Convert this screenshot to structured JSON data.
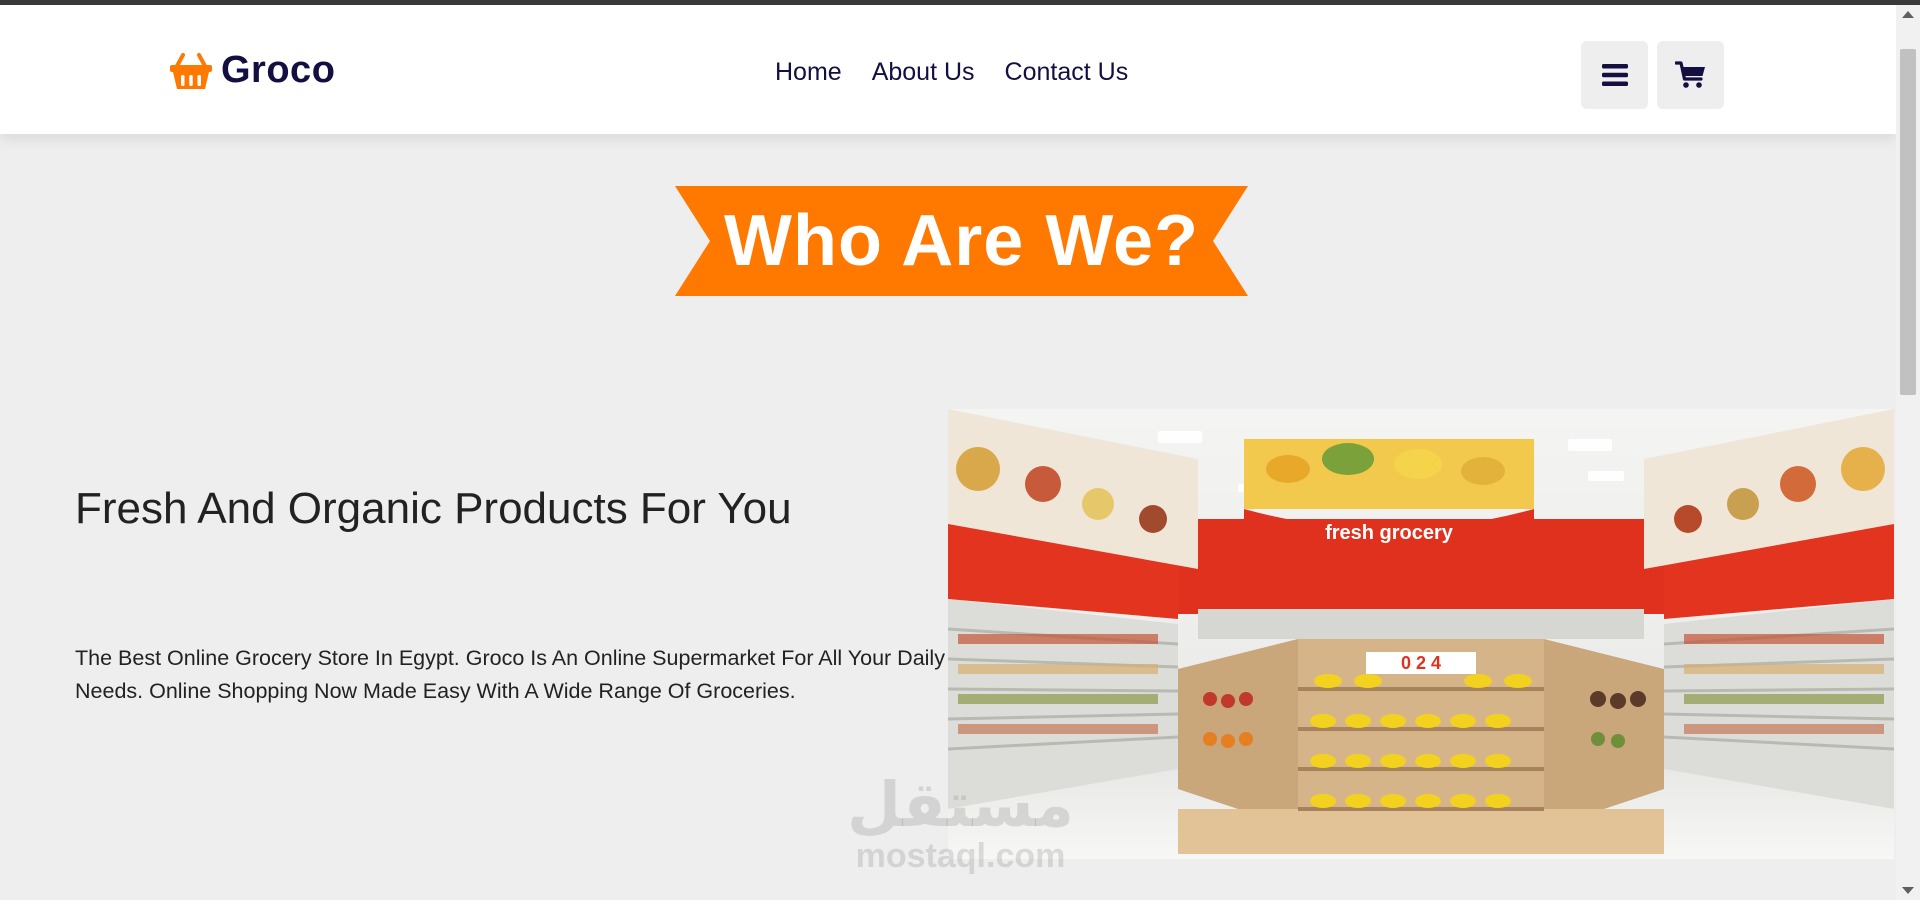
{
  "header": {
    "logo_text": "Groco",
    "nav": [
      "Home",
      "About Us",
      "Contact Us"
    ],
    "menu_icon": "bars-icon",
    "cart_icon": "shopping-cart-icon"
  },
  "about": {
    "heading": "Who Are We?",
    "title": "Fresh And Organic Products For You",
    "description": "The Best Online Grocery Store In Egypt. Groco Is An Online Supermarket For All Your Daily Needs. Online Shopping Now Made Easy With A Wide Range Of Groceries.",
    "image": {
      "sign_text": "fresh grocery",
      "price_text": "0 2 4"
    }
  },
  "watermark": {
    "arabic": "مستقل",
    "latin": "mostaql.com"
  },
  "colors": {
    "accent": "#ff7800",
    "brand_text": "#130f40",
    "page_background": "#eeeeee"
  }
}
